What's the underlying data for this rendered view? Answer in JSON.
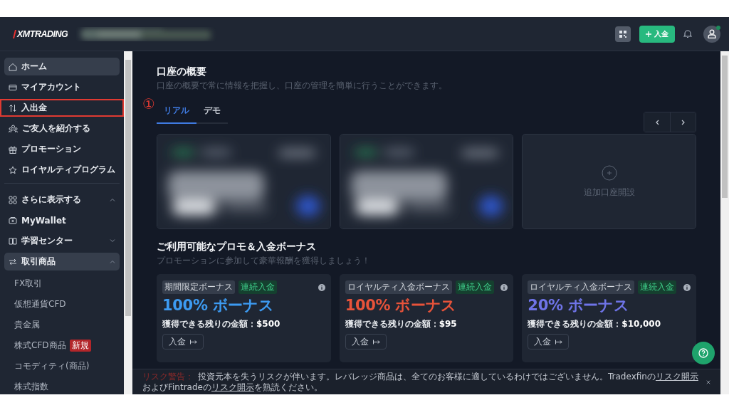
{
  "header": {
    "logo": "XMTRADING",
    "deposit_button": "入金",
    "avatar_online": true
  },
  "sidebar": {
    "items": [
      {
        "label": "ホーム",
        "selected": true,
        "highlighted": false
      },
      {
        "label": "マイアカウント",
        "selected": false,
        "highlighted": false
      },
      {
        "label": "入出金",
        "selected": false,
        "highlighted": true
      },
      {
        "label": "ご友人を紹介する",
        "selected": false,
        "highlighted": false
      },
      {
        "label": "プロモーション",
        "selected": false,
        "highlighted": false
      },
      {
        "label": "ロイヤルティプログラム",
        "selected": false,
        "highlighted": false
      }
    ],
    "groups": [
      {
        "label": "さらに表示する",
        "selected": false,
        "expanded": true
      },
      {
        "label": "MyWallet",
        "selected": false
      },
      {
        "label": "学習センター",
        "selected": false,
        "expanded": false
      },
      {
        "label": "取引商品",
        "selected": true,
        "expanded": true,
        "children": [
          {
            "label": "FX取引"
          },
          {
            "label": "仮想通貨CFD"
          },
          {
            "label": "貴金属"
          },
          {
            "label": "株式CFD商品",
            "badge": "新規"
          },
          {
            "label": "コモディティ(商品)"
          },
          {
            "label": "株式指数"
          }
        ]
      }
    ]
  },
  "annotation": {
    "marker": "①"
  },
  "overview": {
    "title": "口座の概要",
    "subtitle": "口座の概要で常に情報を把握し、口座の管理を簡単に行うことができます。",
    "tabs": [
      {
        "label": "リアル",
        "selected": true
      },
      {
        "label": "デモ",
        "selected": false
      }
    ],
    "accounts": [
      {
        "kind": "picture"
      },
      {
        "kind": "picture"
      },
      {
        "kind": "add",
        "label": "追加口座開設"
      }
    ]
  },
  "promotions": {
    "title": "ご利用可能なプロモ＆入金ボーナス",
    "subtitle": "プロモーションに参加して豪華報酬を獲得しましょう！",
    "cards": [
      {
        "tags": [
          {
            "text": "期間限定ボーナス",
            "kind": "gray"
          },
          {
            "text": "連続入金",
            "kind": "green"
          }
        ],
        "headline": "100% ボーナス",
        "color": "#3d9bf2",
        "amount_label": "獲得できる残りの金額：",
        "amount": "$500",
        "button": "入金"
      },
      {
        "tags": [
          {
            "text": "ロイヤルティ入金ボーナス",
            "kind": "gray"
          },
          {
            "text": "連続入金",
            "kind": "green"
          }
        ],
        "headline": "100% ボーナス",
        "color": "#e8533a",
        "amount_label": "獲得できる残りの金額：",
        "amount": "$95",
        "button": "入金"
      },
      {
        "tags": [
          {
            "text": "ロイヤルティ入金ボーナス",
            "kind": "gray"
          },
          {
            "text": "連続入金",
            "kind": "green"
          }
        ],
        "headline": "20% ボーナス",
        "color": "#6f74e8",
        "amount_label": "獲得できる残りの金額：",
        "amount": "$10,000",
        "button": "入金"
      }
    ]
  },
  "risk_warning": {
    "label": "リスク警告：",
    "parts": [
      {
        "kind": "text",
        "text": "投資元本を失うリスクが伴います。レバレッジ商品は、全てのお客様に適しているわけではございません。Tradexfinの"
      },
      {
        "kind": "link",
        "text": "リスク開示"
      },
      {
        "kind": "text",
        "text": "およびFintradeの"
      },
      {
        "kind": "link",
        "text": "リスク開示"
      },
      {
        "kind": "text",
        "text": "を熟読ください。"
      }
    ]
  }
}
